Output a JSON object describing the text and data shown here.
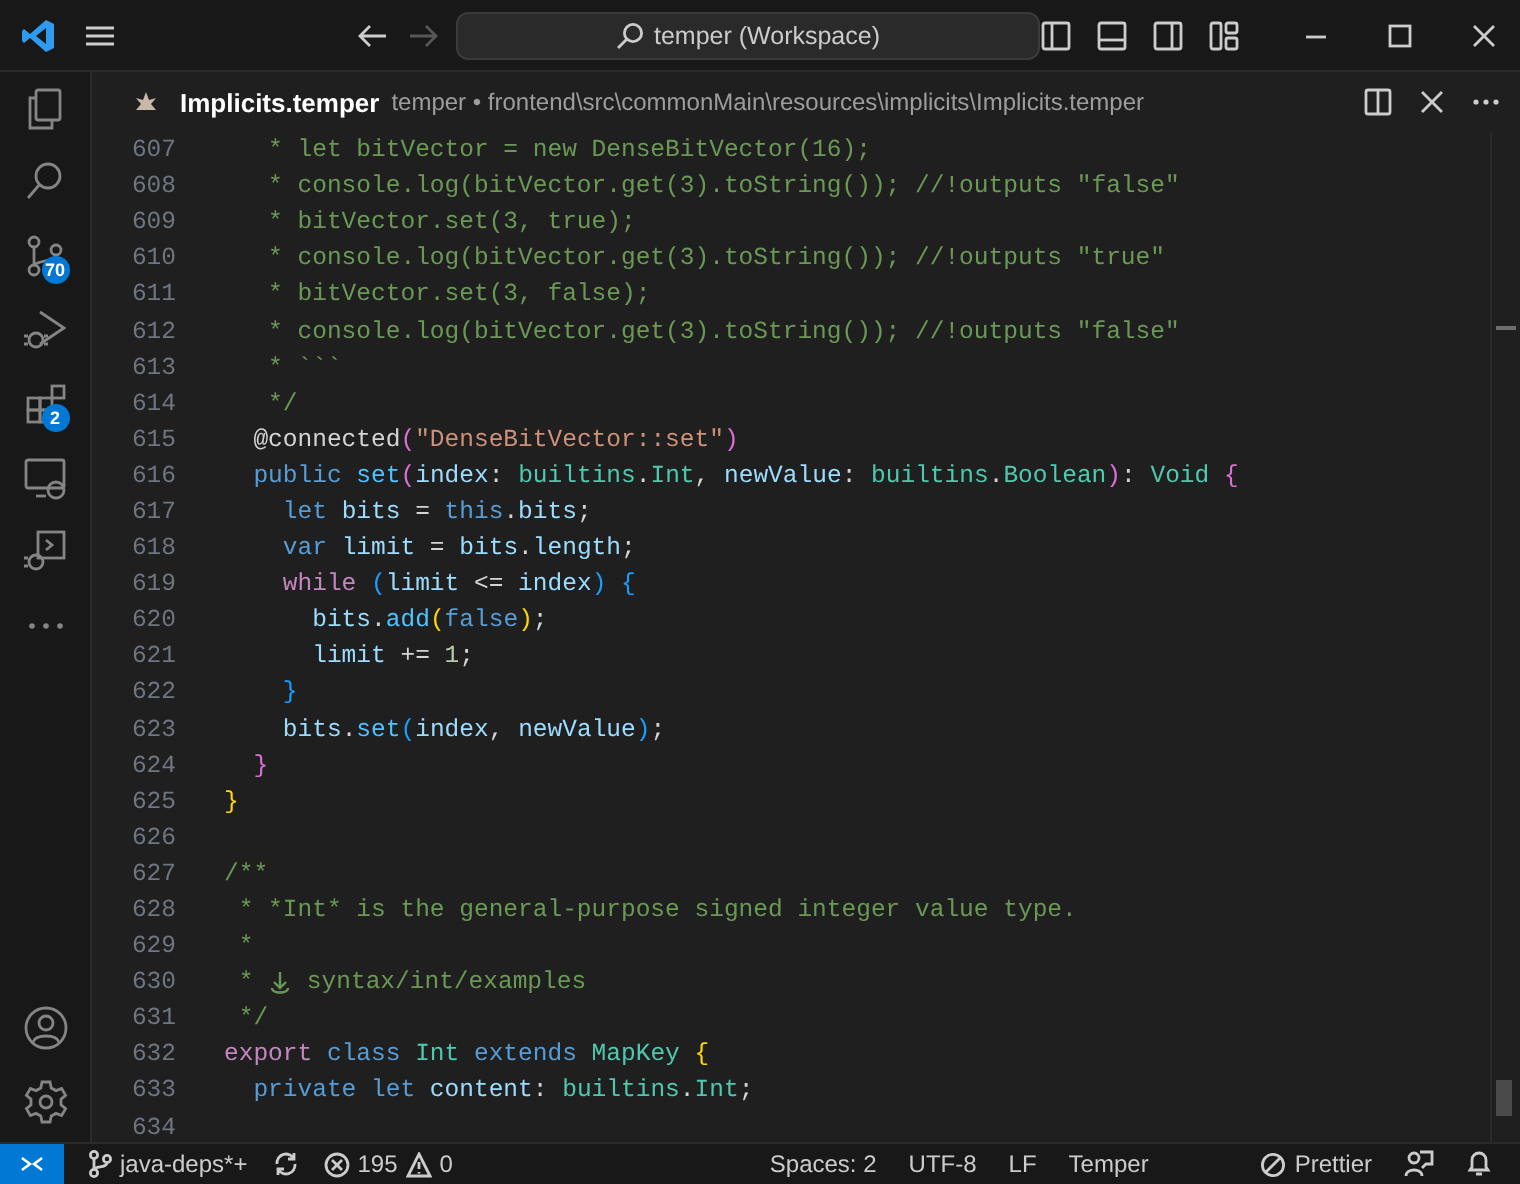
{
  "title_bar": {
    "search": "temper (Workspace)",
    "forward_disabled": true
  },
  "activity_bar": {
    "items": [
      {
        "kind": "explorer"
      },
      {
        "kind": "search"
      },
      {
        "kind": "source-control",
        "badge": "70"
      },
      {
        "kind": "run-debug"
      },
      {
        "kind": "extensions",
        "badge": "2"
      },
      {
        "kind": "remote"
      },
      {
        "kind": "debug-console"
      },
      {
        "kind": "more"
      }
    ],
    "bottom": [
      {
        "kind": "account"
      },
      {
        "kind": "settings"
      }
    ]
  },
  "editor": {
    "tab": {
      "title": "Implicits.temper",
      "path": "temper • frontend\\src\\commonMain\\resources\\implicits\\Implicits.temper"
    },
    "lines": [
      {
        "number": "607",
        "tokens": [
          {
            "kind": "c",
            "text": "   * let bitVector = new DenseBitVector(16);"
          }
        ]
      },
      {
        "number": "608",
        "tokens": [
          {
            "kind": "c",
            "text": "   * console.log(bitVector.get(3).toString()); //!outputs \"false\""
          }
        ]
      },
      {
        "number": "609",
        "tokens": [
          {
            "kind": "c",
            "text": "   * bitVector.set(3, true);"
          }
        ]
      },
      {
        "number": "610",
        "tokens": [
          {
            "kind": "c",
            "text": "   * console.log(bitVector.get(3).toString()); //!outputs \"true\""
          }
        ]
      },
      {
        "number": "611",
        "tokens": [
          {
            "kind": "c",
            "text": "   * bitVector.set(3, false);"
          }
        ]
      },
      {
        "number": "612",
        "tokens": [
          {
            "kind": "c",
            "text": "   * console.log(bitVector.get(3).toString()); //!outputs \"false\""
          }
        ]
      },
      {
        "number": "613",
        "tokens": [
          {
            "kind": "c",
            "text": "   * ```"
          }
        ]
      },
      {
        "number": "614",
        "tokens": [
          {
            "kind": "c",
            "text": "   */"
          }
        ]
      },
      {
        "number": "615",
        "tokens": [
          {
            "kind": "p",
            "text": "  @connected"
          },
          {
            "kind": "b2",
            "text": "("
          },
          {
            "kind": "s",
            "text": "\"DenseBitVector::set\""
          },
          {
            "kind": "b2",
            "text": ")"
          }
        ]
      },
      {
        "number": "616",
        "tokens": [
          {
            "kind": "k",
            "text": "  public "
          },
          {
            "kind": "m",
            "text": "set"
          },
          {
            "kind": "b2",
            "text": "("
          },
          {
            "kind": "v",
            "text": "index"
          },
          {
            "kind": "p",
            "text": ": "
          },
          {
            "kind": "t",
            "text": "builtins"
          },
          {
            "kind": "p",
            "text": "."
          },
          {
            "kind": "t",
            "text": "Int"
          },
          {
            "kind": "p",
            "text": ", "
          },
          {
            "kind": "v",
            "text": "newValue"
          },
          {
            "kind": "p",
            "text": ": "
          },
          {
            "kind": "t",
            "text": "builtins"
          },
          {
            "kind": "p",
            "text": "."
          },
          {
            "kind": "t",
            "text": "Boolean"
          },
          {
            "kind": "b2",
            "text": ")"
          },
          {
            "kind": "p",
            "text": ": "
          },
          {
            "kind": "t",
            "text": "Void "
          },
          {
            "kind": "b2",
            "text": "{"
          }
        ]
      },
      {
        "number": "617",
        "tokens": [
          {
            "kind": "k",
            "text": "    let "
          },
          {
            "kind": "v",
            "text": "bits"
          },
          {
            "kind": "p",
            "text": " = "
          },
          {
            "kind": "k",
            "text": "this"
          },
          {
            "kind": "p",
            "text": "."
          },
          {
            "kind": "v",
            "text": "bits"
          },
          {
            "kind": "p",
            "text": ";"
          }
        ]
      },
      {
        "number": "618",
        "tokens": [
          {
            "kind": "k",
            "text": "    var "
          },
          {
            "kind": "v",
            "text": "limit"
          },
          {
            "kind": "p",
            "text": " = "
          },
          {
            "kind": "v",
            "text": "bits"
          },
          {
            "kind": "p",
            "text": "."
          },
          {
            "kind": "v",
            "text": "length"
          },
          {
            "kind": "p",
            "text": ";"
          }
        ]
      },
      {
        "number": "619",
        "tokens": [
          {
            "kind": "x",
            "text": "    while "
          },
          {
            "kind": "b3",
            "text": "("
          },
          {
            "kind": "v",
            "text": "limit"
          },
          {
            "kind": "p",
            "text": " <= "
          },
          {
            "kind": "v",
            "text": "index"
          },
          {
            "kind": "b3",
            "text": ") {"
          }
        ]
      },
      {
        "number": "620",
        "tokens": [
          {
            "kind": "v",
            "text": "      bits"
          },
          {
            "kind": "p",
            "text": "."
          },
          {
            "kind": "m",
            "text": "add"
          },
          {
            "kind": "b1",
            "text": "("
          },
          {
            "kind": "k",
            "text": "false"
          },
          {
            "kind": "b1",
            "text": ")"
          },
          {
            "kind": "p",
            "text": ";"
          }
        ]
      },
      {
        "number": "621",
        "tokens": [
          {
            "kind": "v",
            "text": "      limit"
          },
          {
            "kind": "p",
            "text": " += "
          },
          {
            "kind": "n",
            "text": "1"
          },
          {
            "kind": "p",
            "text": ";"
          }
        ]
      },
      {
        "number": "622",
        "tokens": [
          {
            "kind": "b3",
            "text": "    }"
          }
        ]
      },
      {
        "number": "623",
        "tokens": [
          {
            "kind": "v",
            "text": "    bits"
          },
          {
            "kind": "p",
            "text": "."
          },
          {
            "kind": "m",
            "text": "set"
          },
          {
            "kind": "b3",
            "text": "("
          },
          {
            "kind": "v",
            "text": "index"
          },
          {
            "kind": "p",
            "text": ", "
          },
          {
            "kind": "v",
            "text": "newValue"
          },
          {
            "kind": "b3",
            "text": ")"
          },
          {
            "kind": "p",
            "text": ";"
          }
        ]
      },
      {
        "number": "624",
        "tokens": [
          {
            "kind": "b2",
            "text": "  }"
          }
        ]
      },
      {
        "number": "625",
        "tokens": [
          {
            "kind": "b1",
            "text": "}"
          }
        ]
      },
      {
        "number": "626"
      },
      {
        "number": "627",
        "tokens": [
          {
            "kind": "c",
            "text": "/**"
          }
        ]
      },
      {
        "number": "628",
        "tokens": [
          {
            "kind": "c",
            "text": " * *Int* is the general-purpose signed integer value type."
          }
        ]
      },
      {
        "number": "629",
        "tokens": [
          {
            "kind": "c",
            "text": " *"
          }
        ]
      },
      {
        "number": "630",
        "tokens": [
          {
            "kind": "c",
            "text": " * "
          },
          {
            "kind": "icon"
          },
          {
            "kind": "c",
            "text": " syntax/int/examples"
          }
        ]
      },
      {
        "number": "631",
        "tokens": [
          {
            "kind": "c",
            "text": " */"
          }
        ]
      },
      {
        "number": "632",
        "tokens": [
          {
            "kind": "x",
            "text": "export "
          },
          {
            "kind": "k",
            "text": "class "
          },
          {
            "kind": "t",
            "text": "Int "
          },
          {
            "kind": "k",
            "text": "extends "
          },
          {
            "kind": "t",
            "text": "MapKey "
          },
          {
            "kind": "b1",
            "text": "{"
          }
        ]
      },
      {
        "number": "633",
        "tokens": [
          {
            "kind": "k",
            "text": "  private let "
          },
          {
            "kind": "v",
            "text": "content"
          },
          {
            "kind": "p",
            "text": ": "
          },
          {
            "kind": "t",
            "text": "builtins"
          },
          {
            "kind": "p",
            "text": "."
          },
          {
            "kind": "t",
            "text": "Int"
          },
          {
            "kind": "p",
            "text": ";"
          }
        ]
      },
      {
        "number": "634"
      }
    ]
  },
  "status_bar": {
    "branch": "java-deps*+",
    "errors": "195",
    "warnings": "0",
    "right": [
      "Spaces: 2",
      "UTF-8",
      "LF",
      "Temper"
    ],
    "formatter": "Prettier"
  }
}
